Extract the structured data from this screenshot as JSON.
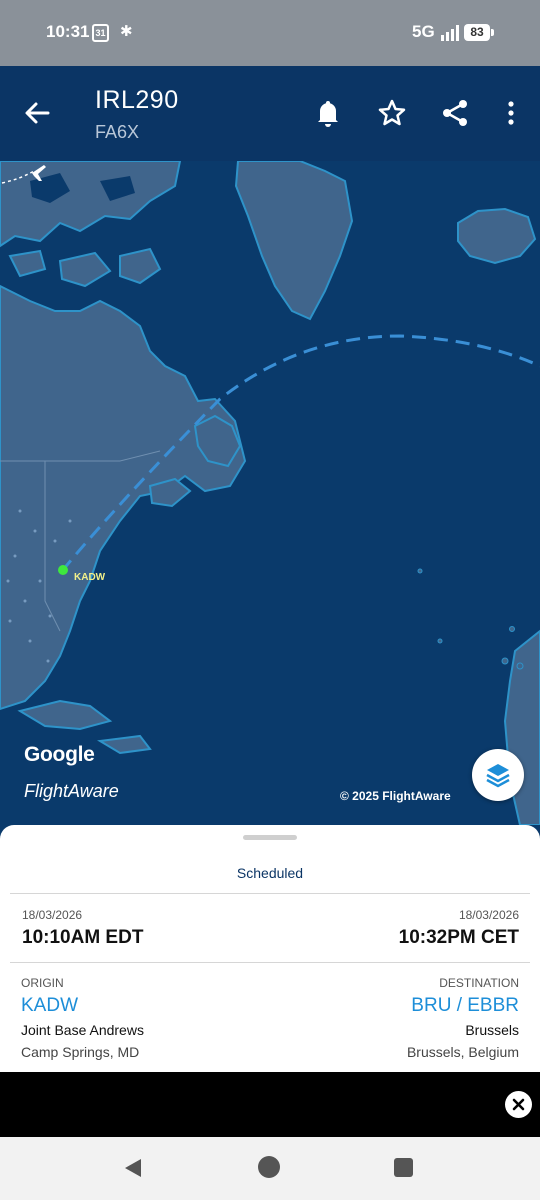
{
  "status_bar": {
    "time": "10:31",
    "calendar_day": "31",
    "network": "5G",
    "battery": "83"
  },
  "header": {
    "flight_number": "IRL290",
    "aircraft_type": "FA6X",
    "icons": [
      "back-arrow-icon",
      "bell-icon",
      "star-icon",
      "share-icon",
      "more-vert-icon"
    ]
  },
  "map": {
    "origin_label": "KADW",
    "google": "Google",
    "flightaware": "FlightAware",
    "copyright": "© 2025 FlightAware",
    "layers_icon": "layers-icon",
    "colors": {
      "ocean": "#0a3a6b",
      "land": "#40658c",
      "route": "#3a8fd6",
      "origin_dot": "#3ee83e"
    }
  },
  "flight_details": {
    "status": "Scheduled",
    "departure_date": "18/03/2026",
    "departure_time": "10:10AM EDT",
    "arrival_date": "18/03/2026",
    "arrival_time": "10:32PM CET",
    "origin": {
      "label": "ORIGIN",
      "code": "KADW",
      "name": "Joint Base Andrews",
      "city": "Camp Springs, MD"
    },
    "destination": {
      "label": "DESTINATION",
      "code": "BRU / EBBR",
      "name": "Brussels",
      "city": "Brussels, Belgium"
    }
  },
  "ad": {
    "close_icon": "close-icon"
  },
  "navigation": {
    "icons": [
      "nav-back-icon",
      "nav-home-icon",
      "nav-recents-icon"
    ]
  }
}
